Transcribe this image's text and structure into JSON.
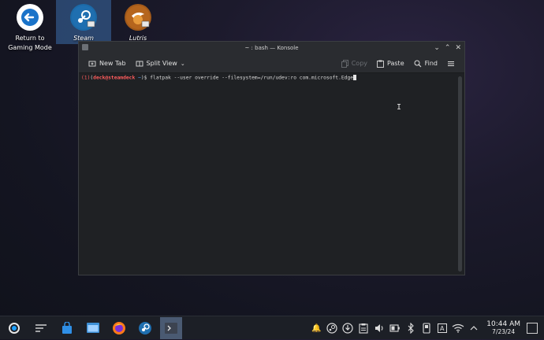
{
  "desktop": {
    "icons": [
      {
        "label_line1": "Return to",
        "label_line2": "Gaming Mode",
        "icon": "return-arrow-icon"
      },
      {
        "label": "Steam",
        "icon": "steam-icon"
      },
      {
        "label": "Lutris",
        "icon": "lutris-icon"
      }
    ]
  },
  "window": {
    "title": "~ : bash — Konsole",
    "toolbar": {
      "new_tab": "New Tab",
      "split_view": "Split View",
      "copy": "Copy",
      "paste": "Paste",
      "find": "Find"
    },
    "terminal": {
      "status": "(1)",
      "user_host": "deck@steamdeck",
      "cwd": "~",
      "prompt_open": "(",
      "prompt_close": ")$",
      "command": "flatpak --user override --filesystem=/run/udev:ro com.microsoft.Edge"
    }
  },
  "taskbar": {
    "clock_time": "10:44 AM",
    "clock_date": "7/23/24"
  }
}
